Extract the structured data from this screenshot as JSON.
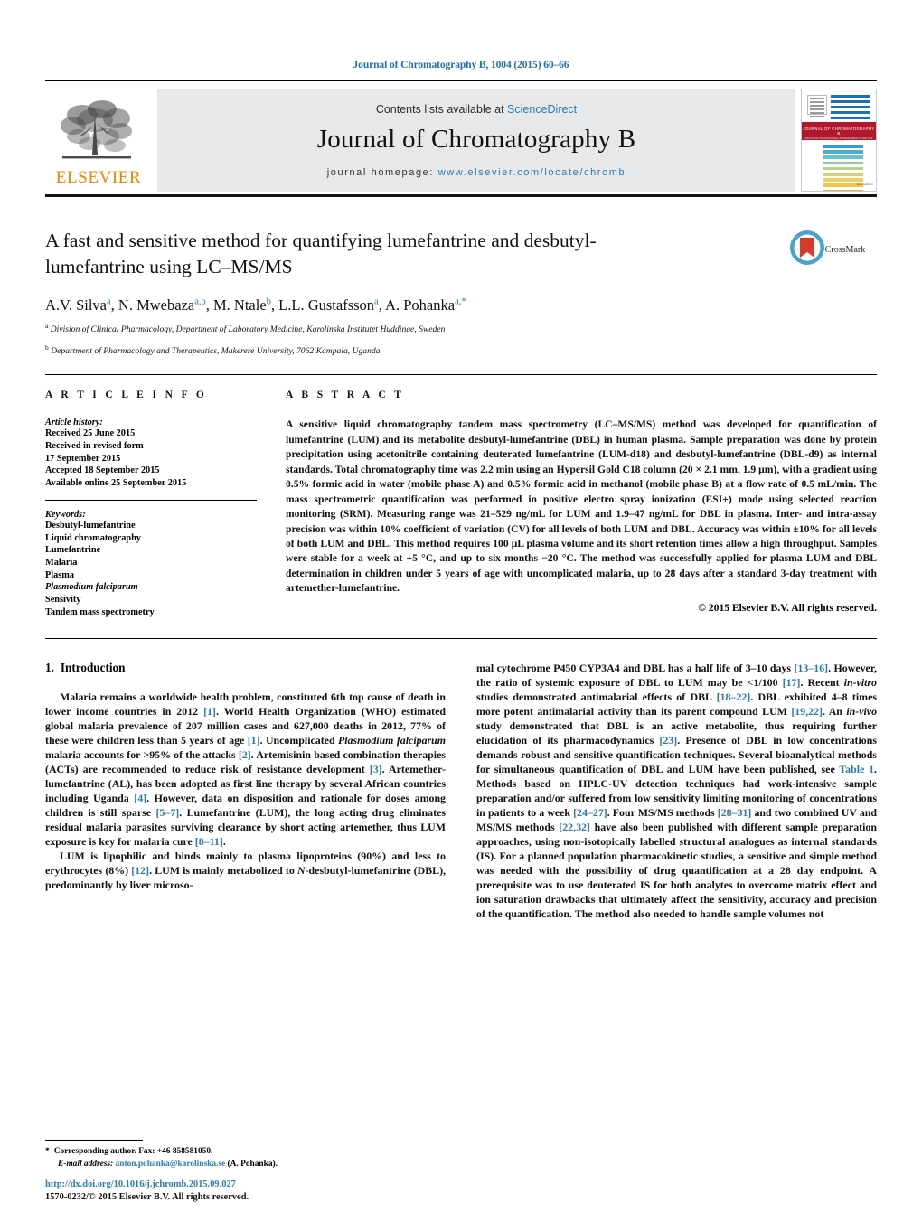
{
  "running_head": "Journal of Chromatography B, 1004 (2015) 60–66",
  "banner": {
    "publisher_name": "ELSEVIER",
    "contents_prefix": "Contents lists available at ",
    "contents_link": "ScienceDirect",
    "journal_title": "Journal of Chromatography B",
    "homepage_prefix": "journal homepage: ",
    "homepage_url": "www.elsevier.com/locate/chromb",
    "cover_banner_title": "JOURNAL OF CHROMATOGRAPHY B",
    "cover_banner_sub": "ANALYTICAL TECHNOLOGIES IN THE BIOMEDICAL AND LIFE SCIENCES",
    "cover_sd_label": "ScienceDirect"
  },
  "article": {
    "title": "A fast and sensitive method for quantifying lumefantrine and desbutyl-lumefantrine using LC–MS/MS",
    "crossmark_label": "CrossMark",
    "authors_html": "A.V. Silva<sup>a</sup>, N. Mwebaza<sup>a,b</sup>, M. Ntale<sup>b</sup>, L.L. Gustafsson<sup>a</sup>, A. Pohanka<sup>a,*</sup>",
    "affiliations": [
      {
        "marker": "a",
        "text": "Division of Clinical Pharmacology, Department of Laboratory Medicine, Karolinska Institutet Huddinge, Sweden"
      },
      {
        "marker": "b",
        "text": "Department of Pharmacology and Therapeutics, Makerere University, 7062 Kampala, Uganda"
      }
    ]
  },
  "info": {
    "heading": "A R T I C L E   I N F O",
    "history_label": "Article history:",
    "history": [
      "Received 25 June 2015",
      "Received in revised form",
      "17 September 2015",
      "Accepted 18 September 2015",
      "Available online 25 September 2015"
    ],
    "keywords_label": "Keywords:",
    "keywords": [
      {
        "text": "Desbutyl-lumefantrine",
        "italic": false
      },
      {
        "text": "Liquid chromatography",
        "italic": false
      },
      {
        "text": "Lumefantrine",
        "italic": false
      },
      {
        "text": "Malaria",
        "italic": false
      },
      {
        "text": "Plasma",
        "italic": false
      },
      {
        "text": "Plasmodium falciparum",
        "italic": true
      },
      {
        "text": "Sensivity",
        "italic": false
      },
      {
        "text": "Tandem mass spectrometry",
        "italic": false
      }
    ]
  },
  "abstract": {
    "heading": "A B S T R A C T",
    "text": "A sensitive liquid chromatography tandem mass spectrometry (LC–MS/MS) method was developed for quantification of lumefantrine (LUM) and its metabolite desbutyl-lumefantrine (DBL) in human plasma. Sample preparation was done by protein precipitation using acetonitrile containing deuterated lumefantrine (LUM-d18) and desbutyl-lumefantrine (DBL-d9) as internal standards. Total chromatography time was 2.2 min using an Hypersil Gold C18 column (20 × 2.1 mm, 1.9 μm), with a gradient using 0.5% formic acid in water (mobile phase A) and 0.5% formic acid in methanol (mobile phase B) at a flow rate of 0.5 mL/min. The mass spectrometric quantification was performed in positive electro spray ionization (ESI+) mode using selected reaction monitoring (SRM). Measuring range was 21–529 ng/mL for LUM and 1.9–47 ng/mL for DBL in plasma. Inter- and intra-assay precision was within 10% coefficient of variation (CV) for all levels of both LUM and DBL. Accuracy was within ±10% for all levels of both LUM and DBL. This method requires 100 μL plasma volume and its short retention times allow a high throughput. Samples were stable for a week at +5 °C, and up to six months −20 °C. The method was successfully applied for plasma LUM and DBL determination in children under 5 years of age with uncomplicated malaria, up to 28 days after a standard 3-day treatment with artemether-lumefantrine.",
    "copyright": "© 2015 Elsevier B.V. All rights reserved."
  },
  "introduction": {
    "number": "1.",
    "heading": "Introduction",
    "left_paragraphs": [
      "Malaria remains a worldwide health problem, constituted 6th top cause of death in lower income countries in 2012 [1]. World Health Organization (WHO) estimated global malaria prevalence of 207 million cases and 627,000 deaths in 2012, 77% of these were children less than 5 years of age [1]. Uncomplicated Plasmodium falciparum malaria accounts for >95% of the attacks [2]. Artemisinin based combination therapies (ACTs) are recommended to reduce risk of resistance development [3]. Artemether-lumefantrine (AL), has been adopted as first line therapy by several African countries including Uganda [4]. However, data on disposition and rationale for doses among children is still sparse [5–7]. Lumefantrine (LUM), the long acting drug eliminates residual malaria parasites surviving clearance by short acting artemether, thus LUM exposure is key for malaria cure [8–11].",
      "LUM is lipophilic and binds mainly to plasma lipoproteins (90%) and less to erythrocytes (8%) [12]. LUM is mainly metabolized to N-desbutyl-lumefantrine (DBL), predominantly by liver microso-"
    ],
    "right_paragraphs": [
      "mal cytochrome P450 CYP3A4 and DBL has a half life of 3–10 days [13–16]. However, the ratio of systemic exposure of DBL to LUM may be <1/100 [17]. Recent in-vitro studies demonstrated antimalarial effects of DBL [18–22]. DBL exhibited 4–8 times more potent antimalarial activity than its parent compound LUM [19,22]. An in-vivo study demonstrated that DBL is an active metabolite, thus requiring further elucidation of its pharmacodynamics [23]. Presence of DBL in low concentrations demands robust and sensitive quantification techniques. Several bioanalytical methods for simultaneous quantification of DBL and LUM have been published, see Table 1. Methods based on HPLC-UV detection techniques had work-intensive sample preparation and/or suffered from low sensitivity limiting monitoring of concentrations in patients to a week [24–27]. Four MS/MS methods [28–31] and two combined UV and MS/MS methods [22,32] have also been published with different sample preparation approaches, using non-isotopically labelled structural analogues as internal standards (IS). For a planned population pharmacokinetic studies, a sensitive and simple method was needed with the possibility of drug quantification at a 28 day endpoint. A prerequisite was to use deuterated IS for both analytes to overcome matrix effect and ion saturation drawbacks that ultimately affect the sensitivity, accuracy and precision of the quantification. The method also needed to handle sample volumes not"
    ]
  },
  "footnote": {
    "star": "*",
    "corresponding": "Corresponding author. Fax: +46 858581050.",
    "email_label": "E-mail address:",
    "email": "anton.pohanka@karolinska.se",
    "email_suffix": " (A. Pohanka)."
  },
  "footer": {
    "doi": "http://dx.doi.org/10.1016/j.jchromb.2015.09.027",
    "issn": "1570-0232/© 2015 Elsevier B.V. All rights reserved."
  },
  "colors": {
    "link": "#2a7ab0",
    "elsevier_orange": "#ef8200",
    "cover_red": "#b2182b"
  }
}
